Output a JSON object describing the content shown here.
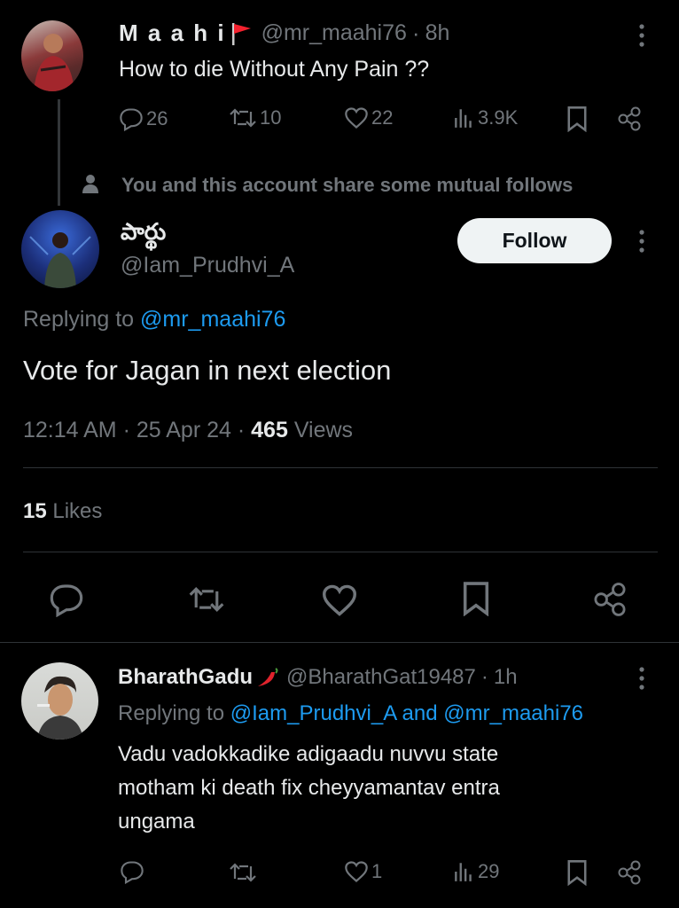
{
  "parent_tweet": {
    "display_name": "M a a h i",
    "handle": "@mr_maahi76",
    "time": "8h",
    "text": "How to die Without Any Pain ??",
    "stats": {
      "replies": "26",
      "reposts": "10",
      "likes": "22",
      "views": "3.9K"
    }
  },
  "mutual_notice": "You and this account share some mutual follows",
  "main_tweet": {
    "display_name": "పార్థు",
    "handle": "@Iam_Prudhvi_A",
    "follow_label": "Follow",
    "replying_prefix": "Replying to",
    "replying_to": "@mr_maahi76",
    "text": "Vote for Jagan in next election",
    "time": "12:14 AM",
    "date": "25 Apr 24",
    "views_count": "465",
    "views_label": "Views",
    "likes_count": "15",
    "likes_label": "Likes"
  },
  "reply_tweet": {
    "display_name": "BharathGadu",
    "handle": "@BharathGat19487",
    "time": "1h",
    "replying_prefix": "Replying to",
    "replying_to_1": "@Iam_Prudhvi_A",
    "replying_and": "and",
    "replying_to_2": "@mr_maahi76",
    "text_line1": "Vadu vadokkadike adigaadu nuvvu state",
    "text_line2": "motham ki death fix cheyyamantav entra",
    "text_line3": "ungama",
    "stats": {
      "likes": "1",
      "views": "29"
    }
  },
  "colors": {
    "background": "#000000",
    "text": "#e7e9ea",
    "muted": "#71767b",
    "link": "#1d9bf0",
    "divider": "#2f3336",
    "flag": "#f4212e"
  }
}
